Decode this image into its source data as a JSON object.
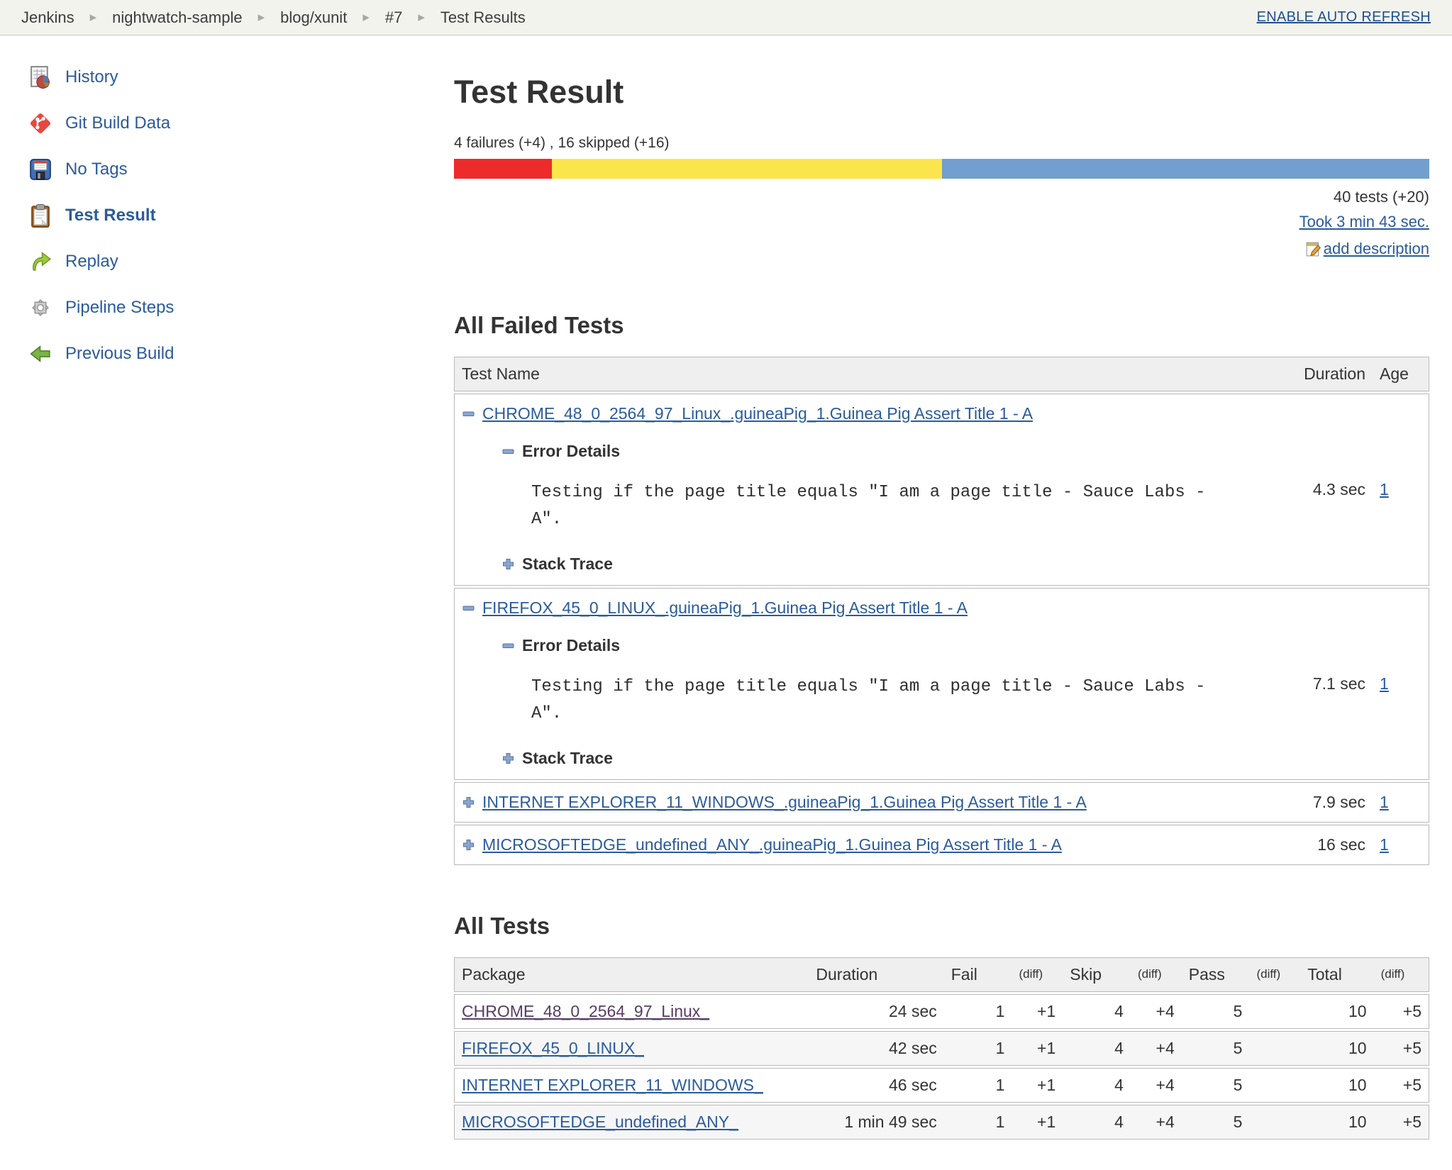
{
  "breadcrumb": {
    "items": [
      "Jenkins",
      "nightwatch-sample",
      "blog/xunit",
      "#7",
      "Test Results"
    ],
    "auto_refresh_label": "ENABLE AUTO REFRESH"
  },
  "sidebar": {
    "items": [
      {
        "label": "History"
      },
      {
        "label": "Git Build Data"
      },
      {
        "label": "No Tags"
      },
      {
        "label": "Test Result"
      },
      {
        "label": "Replay"
      },
      {
        "label": "Pipeline Steps"
      },
      {
        "label": "Previous Build"
      }
    ]
  },
  "summary": {
    "title": "Test Result",
    "failures_line": "4 failures (+4) , 16 skipped (+16)",
    "total_tests": "40 tests (+20)",
    "took_label": "Took 3 min 43 sec.",
    "add_description_label": "add description",
    "bar": {
      "fail_pct": 10,
      "skip_pct": 40,
      "pass_pct": 50,
      "fail_color": "#ee2b2b",
      "skip_color": "#fbe54d",
      "pass_color": "#729fcf"
    }
  },
  "failed_tests": {
    "heading": "All Failed Tests",
    "columns": [
      "Test Name",
      "Duration",
      "Age"
    ],
    "rows": [
      {
        "name": "CHROME_48_0_2564_97_Linux_.guineaPig_1.Guinea Pig Assert Title 1 - A",
        "expanded": true,
        "error_details_label": "Error Details",
        "error_message": "Testing if the page title equals \"I am a page title - Sauce Labs - A\".",
        "stack_trace_label": "Stack Trace",
        "duration": "4.3 sec",
        "age": "1"
      },
      {
        "name": "FIREFOX_45_0_LINUX_.guineaPig_1.Guinea Pig Assert Title 1 - A",
        "expanded": true,
        "error_details_label": "Error Details",
        "error_message": "Testing if the page title equals \"I am a page title - Sauce Labs - A\".",
        "stack_trace_label": "Stack Trace",
        "duration": "7.1 sec",
        "age": "1"
      },
      {
        "name": "INTERNET EXPLORER_11_WINDOWS_.guineaPig_1.Guinea Pig Assert Title 1 - A",
        "expanded": false,
        "duration": "7.9 sec",
        "age": "1"
      },
      {
        "name": "MICROSOFTEDGE_undefined_ANY_.guineaPig_1.Guinea Pig Assert Title 1 - A",
        "expanded": false,
        "duration": "16 sec",
        "age": "1"
      }
    ]
  },
  "all_tests": {
    "heading": "All Tests",
    "columns": [
      "Package",
      "Duration",
      "Fail",
      "(diff)",
      "Skip",
      "(diff)",
      "Pass",
      "(diff)",
      "Total",
      "(diff)"
    ],
    "rows": [
      {
        "package": "CHROME_48_0_2564_97_Linux_",
        "visited": true,
        "duration": "24 sec",
        "fail": "1",
        "fail_diff": "+1",
        "skip": "4",
        "skip_diff": "+4",
        "pass": "5",
        "pass_diff": "",
        "total": "10",
        "total_diff": "+5"
      },
      {
        "package": "FIREFOX_45_0_LINUX_",
        "visited": false,
        "duration": "42 sec",
        "fail": "1",
        "fail_diff": "+1",
        "skip": "4",
        "skip_diff": "+4",
        "pass": "5",
        "pass_diff": "",
        "total": "10",
        "total_diff": "+5"
      },
      {
        "package": "INTERNET EXPLORER_11_WINDOWS_",
        "visited": false,
        "duration": "46 sec",
        "fail": "1",
        "fail_diff": "+1",
        "skip": "4",
        "skip_diff": "+4",
        "pass": "5",
        "pass_diff": "",
        "total": "10",
        "total_diff": "+5"
      },
      {
        "package": "MICROSOFTEDGE_undefined_ANY_",
        "visited": false,
        "duration": "1 min 49 sec",
        "fail": "1",
        "fail_diff": "+1",
        "skip": "4",
        "skip_diff": "+4",
        "pass": "5",
        "pass_diff": "",
        "total": "10",
        "total_diff": "+5"
      }
    ]
  }
}
